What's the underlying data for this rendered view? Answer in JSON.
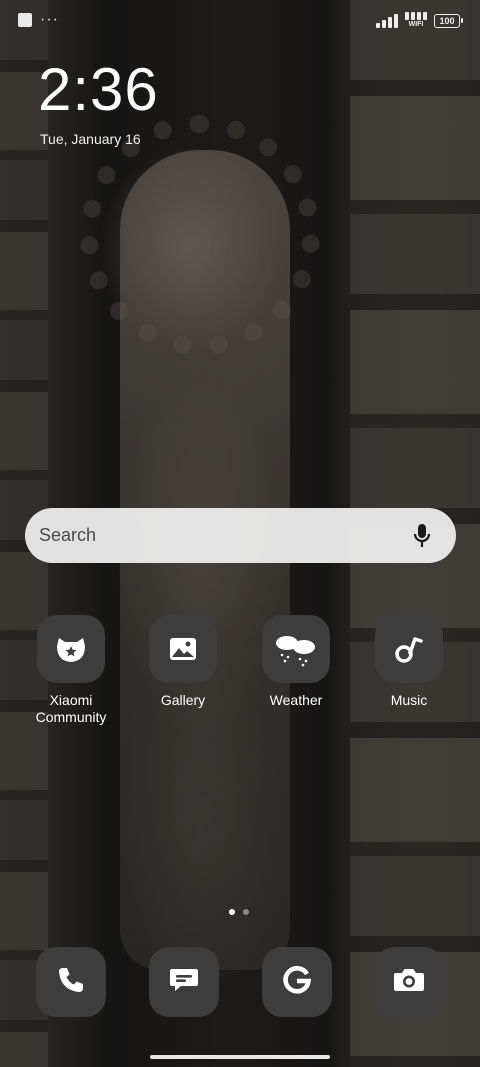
{
  "status_bar": {
    "more_dots": "···",
    "wifi_label": "WIFI",
    "battery_level": "100",
    "signal_bars": 4,
    "wifi_bars": 4
  },
  "lock_clock": {
    "time": "2:36",
    "date": "Tue, January 16"
  },
  "search": {
    "placeholder": "Search",
    "mic_icon": "microphone-icon"
  },
  "apps": [
    {
      "label": "Xiaomi Community",
      "icon": "xiaomi-community-icon"
    },
    {
      "label": "Gallery",
      "icon": "gallery-icon"
    },
    {
      "label": "Weather",
      "icon": "weather-icon"
    },
    {
      "label": "Music",
      "icon": "music-icon"
    }
  ],
  "page_indicator": {
    "total": 2,
    "active": 1
  },
  "dock": [
    {
      "icon": "phone-icon"
    },
    {
      "icon": "messages-icon"
    },
    {
      "icon": "google-icon"
    },
    {
      "icon": "camera-icon"
    }
  ],
  "colors": {
    "icon_background": "#3d3d3d",
    "search_background": "#ececec",
    "text": "#ffffff"
  }
}
